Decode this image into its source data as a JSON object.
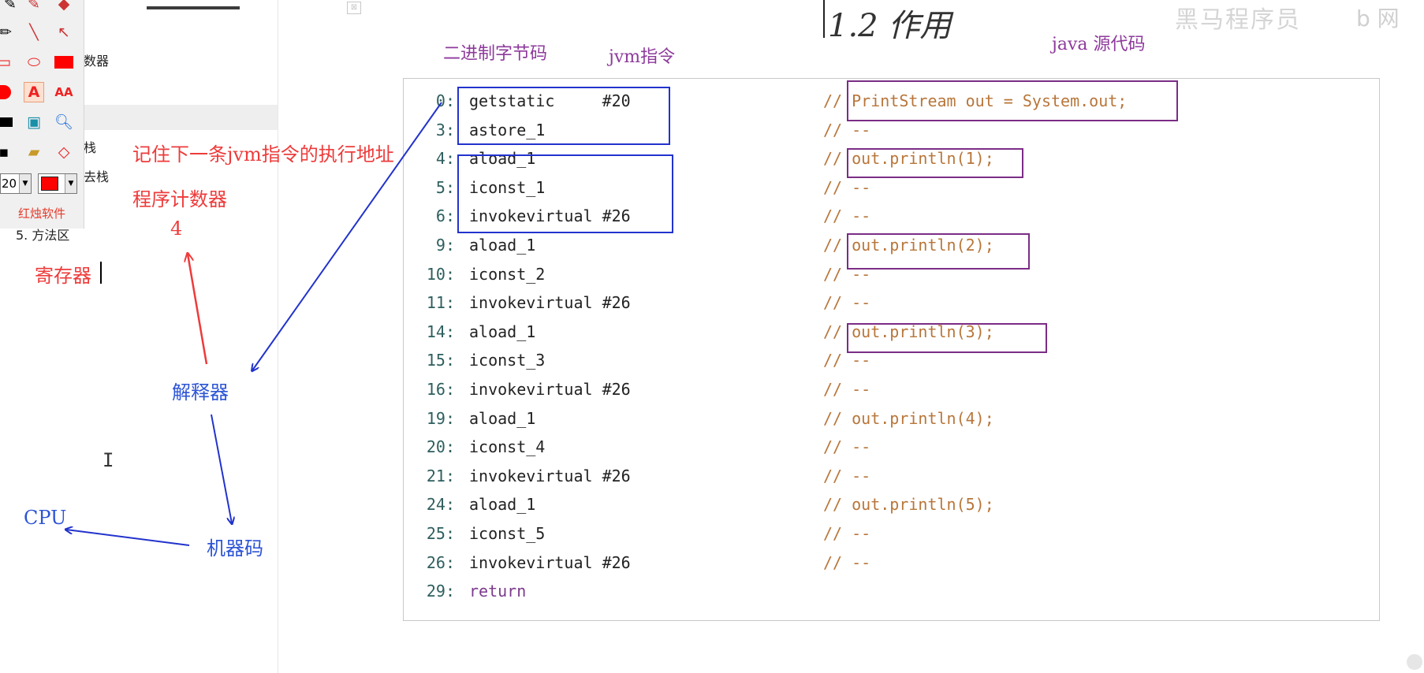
{
  "sidebar": {
    "items": [
      {
        "label": "数器"
      },
      {
        "label": "栈"
      },
      {
        "label": "去栈"
      },
      {
        "label": "5. 方法区"
      }
    ]
  },
  "toolbar": {
    "size_value": "20",
    "color_value": "#ff0000",
    "brand": "红烛软件",
    "tools": [
      "pencil-icon",
      "marker-icon",
      "eraser-icon",
      "pen-icon",
      "line-icon",
      "arrow-icon",
      "rectangle-icon",
      "ellipse-icon",
      "filled-rectangle-icon",
      "filled-circle-icon",
      "text-tool-icon",
      "font-size-icon",
      "fill-color-icon",
      "screen-capture-icon",
      "zoom-icon",
      "save-icon",
      "open-folder-icon",
      "diamond-icon"
    ]
  },
  "annotations": {
    "pc_note": "记住下一条jvm指令的执行地址",
    "pc_label": "程序计数器",
    "pc_value": "4",
    "register": "寄存器",
    "interpreter": "解释器",
    "machine_code": "机器码",
    "cpu": "CPU",
    "binary_bytecode": "二进制字节码",
    "jvm_instructions": "jvm指令",
    "java_source": "java 源代码"
  },
  "title": "1.2 作用",
  "colors": {
    "red": "#ee3b3b",
    "blue": "#2d55d6",
    "purple": "#8e3a9c",
    "comment": "#b8763a",
    "offset": "#2e5e5e",
    "keyword": "#7b3a8c",
    "box_blue": "#2233cc",
    "box_purple": "#7b2d86"
  },
  "code": [
    {
      "offset": "0:",
      "instr": "getstatic     #20",
      "comment": "// PrintStream out = System.out;"
    },
    {
      "offset": "3:",
      "instr": "astore_1",
      "comment": "// --"
    },
    {
      "offset": "4:",
      "instr": "aload_1",
      "comment": "// out.println(1);"
    },
    {
      "offset": "5:",
      "instr": "iconst_1",
      "comment": "// --"
    },
    {
      "offset": "6:",
      "instr": "invokevirtual #26",
      "comment": "// --"
    },
    {
      "offset": "9:",
      "instr": "aload_1",
      "comment": "// out.println(2);"
    },
    {
      "offset": "10:",
      "instr": "iconst_2",
      "comment": "// --"
    },
    {
      "offset": "11:",
      "instr": "invokevirtual #26",
      "comment": "// --"
    },
    {
      "offset": "14:",
      "instr": "aload_1",
      "comment": "// out.println(3);"
    },
    {
      "offset": "15:",
      "instr": "iconst_3",
      "comment": "// --"
    },
    {
      "offset": "16:",
      "instr": "invokevirtual #26",
      "comment": "// --"
    },
    {
      "offset": "19:",
      "instr": "aload_1",
      "comment": "// out.println(4);"
    },
    {
      "offset": "20:",
      "instr": "iconst_4",
      "comment": "// --"
    },
    {
      "offset": "21:",
      "instr": "invokevirtual #26",
      "comment": "// --"
    },
    {
      "offset": "24:",
      "instr": "aload_1",
      "comment": "// out.println(5);"
    },
    {
      "offset": "25:",
      "instr": "iconst_5",
      "comment": "// --"
    },
    {
      "offset": "26:",
      "instr": "invokevirtual #26",
      "comment": "// --"
    },
    {
      "offset": "29:",
      "instr": "return",
      "comment": ""
    }
  ]
}
